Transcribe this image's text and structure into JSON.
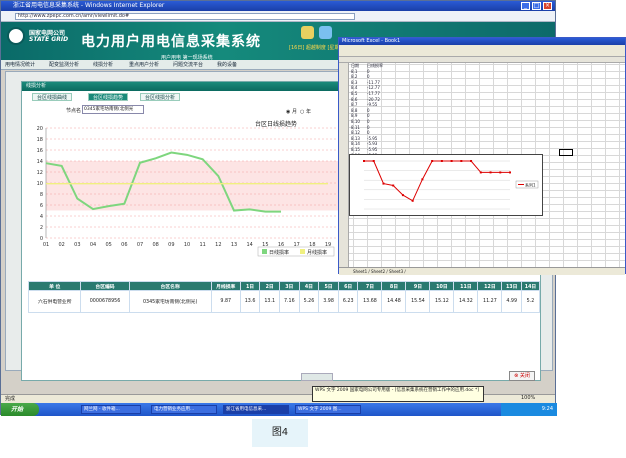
{
  "ie": {
    "title": "浙江省用电信息采集系统 - Windows Internet Explorer",
    "address": "http://www.zpepc.com.cn/amr/viewlimit.do#"
  },
  "banner": {
    "logo_cn": "国家电网公司",
    "logo_en": "STATE GRID",
    "title": "电力用户用电信息采集系统",
    "subtitle": "用户用电 第一现场系统",
    "info": "[16日] 超越制度 [星期五]"
  },
  "menu": [
    "用电情况统计",
    "配变监测分析",
    "线损分析",
    "重点用户分析",
    "问题交流平台",
    "我的设备"
  ],
  "panel": {
    "title": "线损分析",
    "tabs": [
      "台区线损曲线",
      "台区线损趋势",
      "台区线损分析"
    ],
    "station_label": "节点名",
    "station_value": "0345家宅坊南侧(北侧光",
    "radio_month": "月",
    "radio_year": "年"
  },
  "chart_data": {
    "type": "line",
    "title": "台区日线损趋势",
    "ylim": [
      0,
      20
    ],
    "yticks": [
      "0",
      "2",
      "4",
      "6",
      "8",
      "10",
      "12",
      "14",
      "16",
      "18",
      "20"
    ],
    "categories": [
      "01",
      "02",
      "03",
      "04",
      "05",
      "06",
      "07",
      "08",
      "09",
      "10",
      "11",
      "12",
      "13",
      "14",
      "15",
      "16",
      "17",
      "18",
      "19"
    ],
    "series": [
      {
        "name": "日线损率",
        "color": "#7ed67e",
        "values": [
          13.6,
          13.1,
          7.16,
          5.26,
          5.8,
          6.23,
          13.68,
          14.48,
          15.54,
          15.12,
          14.32,
          11.27,
          4.99,
          5.2,
          4.8,
          4.8
        ]
      },
      {
        "name": "月线损率",
        "color": "#f0f080",
        "values": [
          9.87,
          9.87,
          9.87,
          9.87,
          9.87,
          9.87,
          9.87,
          9.87,
          9.87,
          9.87,
          9.87,
          9.87,
          9.87,
          9.87,
          9.87,
          9.87,
          9.87,
          9.87,
          9.87
        ]
      }
    ],
    "legend": [
      "日线损率",
      "月线损率"
    ]
  },
  "table": {
    "headers": [
      "单 位",
      "台区编码",
      "台区名称",
      "月线损率",
      "1日",
      "2日",
      "3日",
      "4日",
      "5日",
      "6日",
      "7日",
      "8日",
      "9日",
      "10日",
      "11日",
      "12日",
      "13日",
      "14日"
    ],
    "row": [
      "六石供电营业所",
      "0000678956",
      "0345家宅坊南侧(北侧光)",
      "9.87",
      "13.6",
      "13.1",
      "7.16",
      "5.26",
      "3.98",
      "6.23",
      "13.68",
      "14.48",
      "15.54",
      "15.12",
      "14.32",
      "11.27",
      "4.99",
      "5.2"
    ]
  },
  "close_label": "关闭",
  "status": {
    "text": "完成",
    "zoom": "100%"
  },
  "excel": {
    "title": "Microsoft Excel - Book1",
    "sheet_tabs": "Sheet1 / Sheet2 / Sheet3 /",
    "legend": "系列1",
    "rows": [
      "1",
      "2",
      "3",
      "4",
      "5",
      "6",
      "7",
      "8",
      "9",
      "10",
      "11",
      "12",
      "13",
      "14",
      "15",
      "16"
    ],
    "col_a": [
      "日期",
      "8.1",
      "8.2",
      "8.3",
      "8.4",
      "8.5",
      "8.6",
      "8.7",
      "8.8",
      "8.9",
      "8.10",
      "8.11",
      "8.12",
      "8.13",
      "8.14",
      "8.15",
      "8.16"
    ],
    "col_b": [
      "日线损率",
      "0",
      "0",
      "-11.77",
      "-12.77",
      "-17.77",
      "-20.72",
      "-9.55",
      "0",
      "0",
      "0",
      "0",
      "0",
      "-5.95",
      "-5.93",
      "-5.95",
      "-5.95"
    ],
    "values": [
      0,
      0,
      -11.77,
      -12.77,
      -17.77,
      -20.72,
      -9.55,
      0,
      0,
      0,
      0,
      0,
      -5.95,
      -5.93,
      -5.95,
      -5.95
    ]
  },
  "taskbar": {
    "start": "开始",
    "tasks": [
      "网兰网 - 收件箱...",
      "电力营销业务应用...",
      "浙江省用电信息采...",
      "WPS 文字 2009 图..."
    ],
    "clock": "9:24"
  },
  "tooltip": "WPS 文字 2009 国家电网公司专用版 - [信息采集系统在营销工作中的应用.doc *]",
  "caption": "图4"
}
